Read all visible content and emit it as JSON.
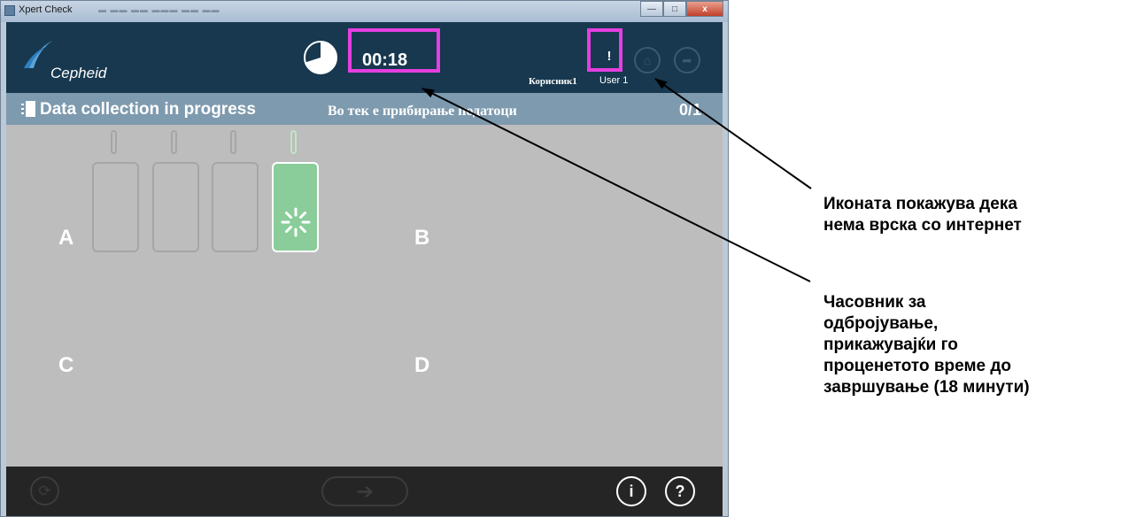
{
  "window": {
    "title": "Xpert Check",
    "minimize_icon": "minimize-icon",
    "maximize_icon": "maximize-icon",
    "close_label": "x"
  },
  "header": {
    "logo_text": "Cepheid",
    "timer": "00:18",
    "timer_progress": 0.7,
    "network_icon": "no-internet-icon",
    "network_symbol": "!",
    "user_label_mk": "Корисник1",
    "user_label": "User 1",
    "home_icon": "home-icon",
    "exit_icon": "exit-icon"
  },
  "status": {
    "text": "Data collection in progress",
    "text_mk": "Во тек е прибирање податоци",
    "count": "0/1"
  },
  "slots": {
    "a": "A",
    "b": "B",
    "c": "C",
    "d": "D"
  },
  "modules": [
    {
      "state": "idle"
    },
    {
      "state": "idle"
    },
    {
      "state": "idle"
    },
    {
      "state": "running"
    }
  ],
  "footer": {
    "refresh_icon": "refresh-icon",
    "next_icon": "arrow-right-icon",
    "info_label": "i",
    "help_label": "?"
  },
  "annotations": {
    "network_note": [
      "Иконата покажува дека",
      "нема врска со интернет"
    ],
    "timer_note": [
      "Часовник за",
      "одбројување,",
      "прикажувајќи го",
      "проценетото време до",
      "завршување (18 минути)"
    ]
  },
  "colors": {
    "header_bg": "#17384f",
    "status_bg": "#7e9aae",
    "main_bg": "#bdbdbd",
    "footer_bg": "#252525",
    "highlight": "#e43fe0",
    "active_module": "#8acd9a"
  }
}
